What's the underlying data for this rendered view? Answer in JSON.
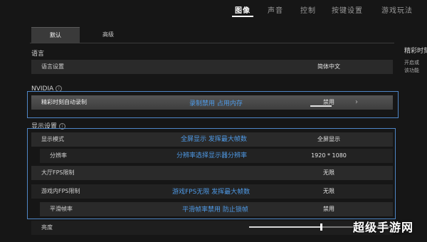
{
  "nav": {
    "tabs": [
      "图像",
      "声音",
      "控制",
      "按键设置",
      "游戏玩法"
    ]
  },
  "subtabs": {
    "default": "默认",
    "advanced": "高级"
  },
  "language": {
    "section_title": "语言",
    "row_label": "语言设置",
    "row_value": "简体中文"
  },
  "nvidia": {
    "section_title": "NVIDIA",
    "row_label": "精彩时刻自动录制",
    "row_value": "禁用",
    "annotation": "录制禁用 占用内存"
  },
  "display": {
    "section_title": "显示设置",
    "rows": [
      {
        "label": "显示模式",
        "value": "全屏显示"
      },
      {
        "label": "分辨率",
        "value": "1920 * 1080"
      },
      {
        "label": "大厅FPS限制",
        "value": "无限"
      },
      {
        "label": "游戏内FPS限制",
        "value": "无限"
      },
      {
        "label": "平滑帧率",
        "value": "禁用"
      },
      {
        "label": "亮度",
        "value": ""
      }
    ],
    "annotations": [
      "全屏显示 发挥最大帧数",
      "分辨率选择显示器分辨率",
      "游戏FPS无限 发挥最大帧数",
      "平滑帧率禁用 防止锁帧"
    ],
    "brightness_level": 0.5
  },
  "right_panel": {
    "title": "精彩时刻",
    "desc_line1": "开启或",
    "desc_line2": "该功能"
  },
  "watermark": "超级手游网"
}
